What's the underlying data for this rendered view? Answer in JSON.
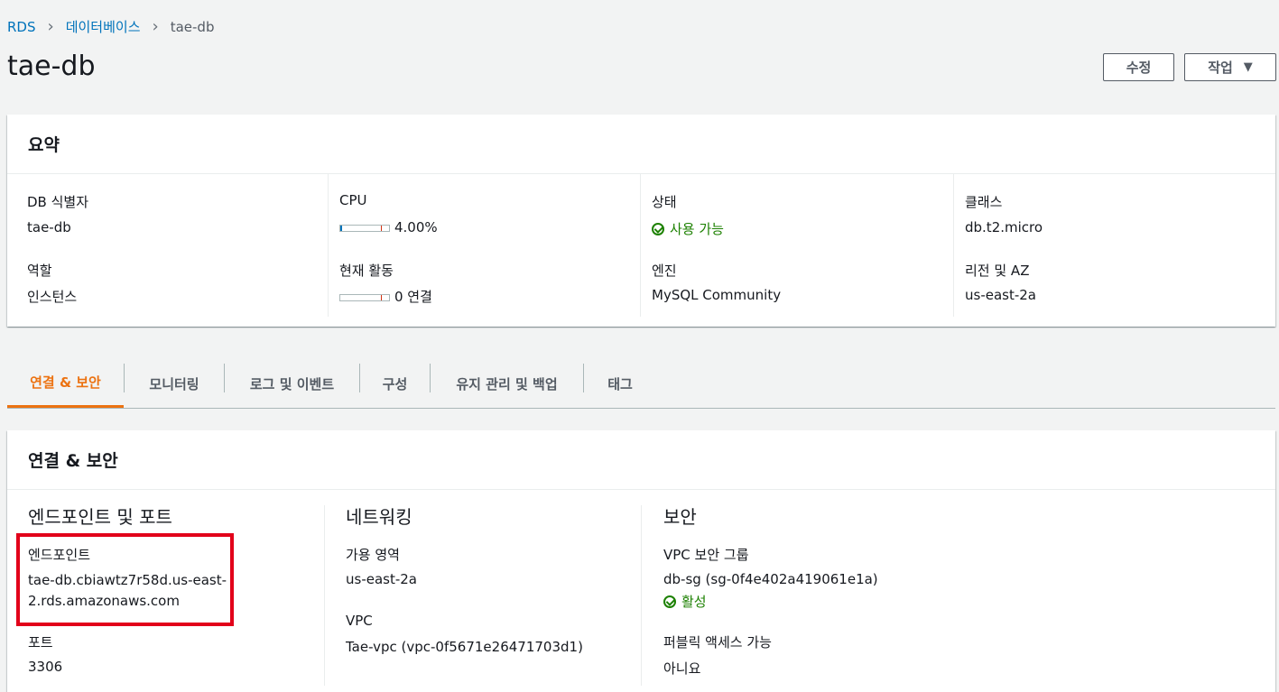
{
  "breadcrumb": [
    "RDS",
    "데이터베이스",
    "tae-db"
  ],
  "page_title": "tae-db",
  "buttons": {
    "modify": "수정",
    "actions": "작업"
  },
  "summary": {
    "title": "요약",
    "db_id_label": "DB 식별자",
    "db_id": "tae-db",
    "role_label": "역할",
    "role": "인스턴스",
    "cpu_label": "CPU",
    "cpu": "4.00%",
    "cpu_fraction": 0.04,
    "activity_label": "현재 활동",
    "activity": "0 연결",
    "status_label": "상태",
    "status": "사용 가능",
    "engine_label": "엔진",
    "engine": "MySQL Community",
    "class_label": "클래스",
    "class": "db.t2.micro",
    "region_label": "리전 및 AZ",
    "region": "us-east-2a"
  },
  "tabs": [
    "연결 & 보안",
    "모니터링",
    "로그 및 이벤트",
    "구성",
    "유지 관리 및 백업",
    "태그"
  ],
  "connectivity": {
    "title": "연결 & 보안",
    "endpoint_section": "엔드포인트 및 포트",
    "endpoint_label": "엔드포인트",
    "endpoint_line1": "tae-db.cbiawtz7r58d.us-east-",
    "endpoint_line2": "2.rds.amazonaws.com",
    "port_label": "포트",
    "port": "3306",
    "network_section": "네트워킹",
    "az_label": "가용 영역",
    "az": "us-east-2a",
    "vpc_label": "VPC",
    "vpc": "Tae-vpc (vpc-0f5671e26471703d1)",
    "security_section": "보안",
    "sg_label": "VPC 보안 그룹",
    "sg": "db-sg (sg-0f4e402a419061e1a)",
    "sg_status": "활성",
    "public_label": "퍼블릭 액세스 가능",
    "public": "아니요"
  },
  "colors": {
    "accent": "#ec7211",
    "link": "#0073bb",
    "ok": "#1d8102",
    "highlight": "#e2001a"
  }
}
